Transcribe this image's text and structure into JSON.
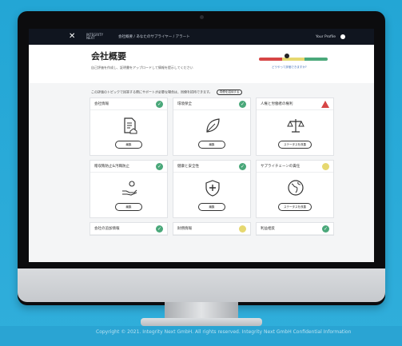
{
  "app": {
    "logo_text": "INTEGRITY NEXT",
    "breadcrumb": "会社概要 / あなたのサプライヤー / アラート",
    "user_label": "Your Profile"
  },
  "header": {
    "title": "会社概要",
    "subtitle": "自己評価を作成し、証明書をアップロードして情報を提示してください",
    "scale_link": "どうやって評価できますか?",
    "scale_colors": [
      "#d64545",
      "#e6d870",
      "#4aa87a"
    ]
  },
  "notice": {
    "text": "この評価のトピックで回答する際にサポートが必要な場合は、同僚を招待できます。",
    "button": "同僚を招待する"
  },
  "cards": [
    {
      "title": "会社情報",
      "status": "ok",
      "icon": "document-house-icon",
      "button": "編集"
    },
    {
      "title": "環境保全",
      "status": "ok",
      "icon": "leaf-icon",
      "button": "編集"
    },
    {
      "title": "人権と労働者の権利",
      "status": "warn",
      "icon": "scales-icon",
      "button": "ステータスを改善"
    },
    {
      "title": "贈収賄防止&汚職防止",
      "status": "ok",
      "icon": "money-hand-icon",
      "button": "編集"
    },
    {
      "title": "健康と安全性",
      "status": "ok",
      "icon": "shield-cross-icon",
      "button": "編集"
    },
    {
      "title": "サプライチェーンの責任",
      "status": "pending",
      "icon": "globe-icon",
      "button": "ステータスを改善"
    },
    {
      "title": "会社の追加情報",
      "status": "ok",
      "icon": "",
      "button": ""
    },
    {
      "title": "財務情報",
      "status": "pending",
      "icon": "",
      "button": ""
    },
    {
      "title": "利益相反",
      "status": "ok",
      "icon": "",
      "button": ""
    }
  ],
  "footer": {
    "copyright": "Copyright © 2021. Integrity Next GmbH. All rights reserved. Integrity Next GmbH Confidential Information"
  }
}
